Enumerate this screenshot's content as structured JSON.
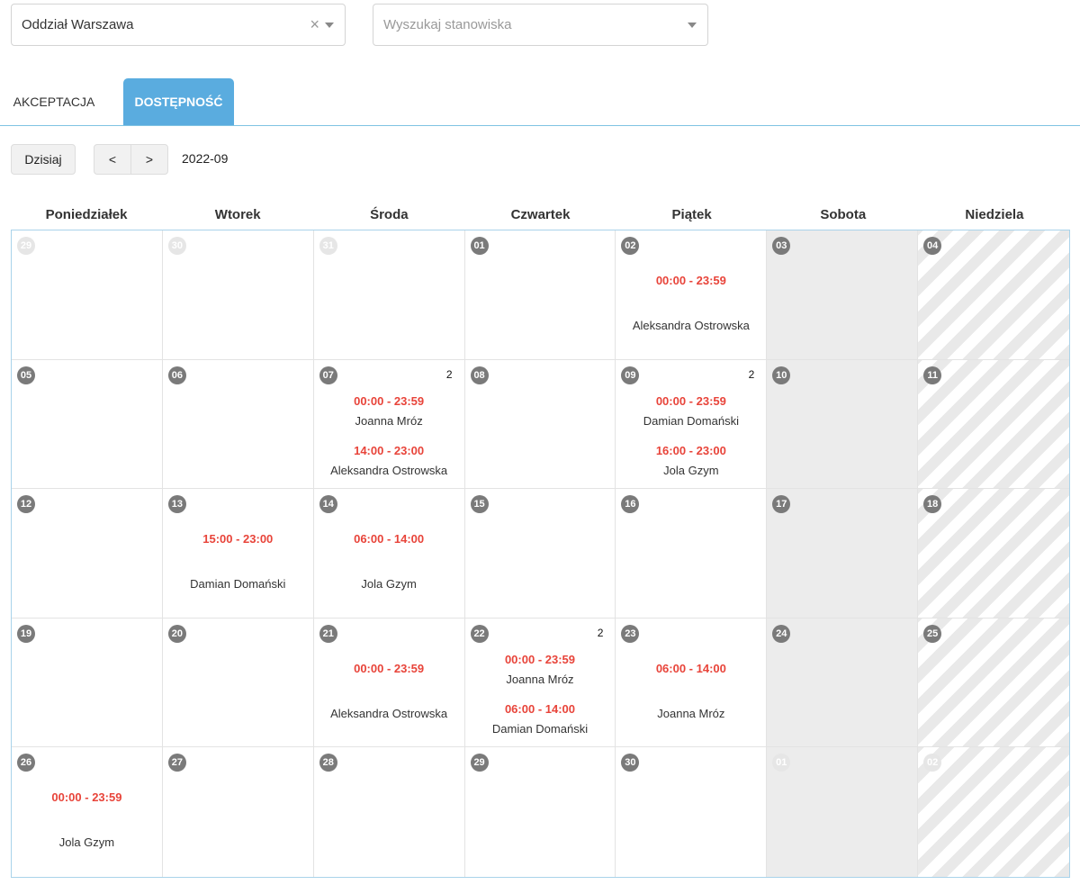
{
  "filters": {
    "branch": {
      "value": "Oddział Warszawa",
      "clear_icon": "×"
    },
    "position": {
      "placeholder": "Wyszukaj stanowiska"
    }
  },
  "tabs": [
    {
      "label": "AKCEPTACJA",
      "active": false
    },
    {
      "label": "DOSTĘPNOŚĆ",
      "active": true
    }
  ],
  "toolbar": {
    "today_label": "Dzisiaj",
    "prev_label": "<",
    "next_label": ">",
    "period": "2022-09"
  },
  "colors": {
    "accent": "#5aacdf",
    "shift_time": "#e8443a",
    "weekend_sat": "#ececec"
  },
  "weekdays": [
    "Poniedziałek",
    "Wtorek",
    "Środa",
    "Czwartek",
    "Piątek",
    "Sobota",
    "Niedziela"
  ],
  "weeks": [
    [
      {
        "day": "29",
        "other": true,
        "shifts": []
      },
      {
        "day": "30",
        "other": true,
        "shifts": []
      },
      {
        "day": "31",
        "other": true,
        "shifts": []
      },
      {
        "day": "01",
        "shifts": []
      },
      {
        "day": "02",
        "shifts": [
          {
            "time": "00:00 - 23:59",
            "person": "Aleksandra Ostrowska"
          }
        ]
      },
      {
        "day": "03",
        "shifts": []
      },
      {
        "day": "04",
        "shifts": []
      }
    ],
    [
      {
        "day": "05",
        "shifts": []
      },
      {
        "day": "06",
        "shifts": []
      },
      {
        "day": "07",
        "count": "2",
        "shifts": [
          {
            "time": "00:00 - 23:59",
            "person": "Joanna Mróz"
          },
          {
            "time": "14:00 - 23:00",
            "person": "Aleksandra Ostrowska"
          }
        ]
      },
      {
        "day": "08",
        "shifts": []
      },
      {
        "day": "09",
        "count": "2",
        "shifts": [
          {
            "time": "00:00 - 23:59",
            "person": "Damian Domański"
          },
          {
            "time": "16:00 - 23:00",
            "person": "Jola Gzym"
          }
        ]
      },
      {
        "day": "10",
        "shifts": []
      },
      {
        "day": "11",
        "shifts": []
      }
    ],
    [
      {
        "day": "12",
        "shifts": []
      },
      {
        "day": "13",
        "shifts": [
          {
            "time": "15:00 - 23:00",
            "person": "Damian Domański"
          }
        ]
      },
      {
        "day": "14",
        "shifts": [
          {
            "time": "06:00 - 14:00",
            "person": "Jola Gzym"
          }
        ]
      },
      {
        "day": "15",
        "shifts": []
      },
      {
        "day": "16",
        "shifts": []
      },
      {
        "day": "17",
        "shifts": []
      },
      {
        "day": "18",
        "shifts": []
      }
    ],
    [
      {
        "day": "19",
        "shifts": []
      },
      {
        "day": "20",
        "shifts": []
      },
      {
        "day": "21",
        "shifts": [
          {
            "time": "00:00 - 23:59",
            "person": "Aleksandra Ostrowska"
          }
        ]
      },
      {
        "day": "22",
        "count": "2",
        "shifts": [
          {
            "time": "00:00 - 23:59",
            "person": "Joanna Mróz"
          },
          {
            "time": "06:00 - 14:00",
            "person": "Damian Domański"
          }
        ]
      },
      {
        "day": "23",
        "shifts": [
          {
            "time": "06:00 - 14:00",
            "person": "Joanna Mróz"
          }
        ]
      },
      {
        "day": "24",
        "shifts": []
      },
      {
        "day": "25",
        "shifts": []
      }
    ],
    [
      {
        "day": "26",
        "shifts": [
          {
            "time": "00:00 - 23:59",
            "person": "Jola Gzym"
          }
        ]
      },
      {
        "day": "27",
        "shifts": []
      },
      {
        "day": "28",
        "shifts": []
      },
      {
        "day": "29",
        "shifts": []
      },
      {
        "day": "30",
        "shifts": []
      },
      {
        "day": "01",
        "other": true,
        "shifts": []
      },
      {
        "day": "02",
        "other": true,
        "shifts": []
      }
    ]
  ]
}
